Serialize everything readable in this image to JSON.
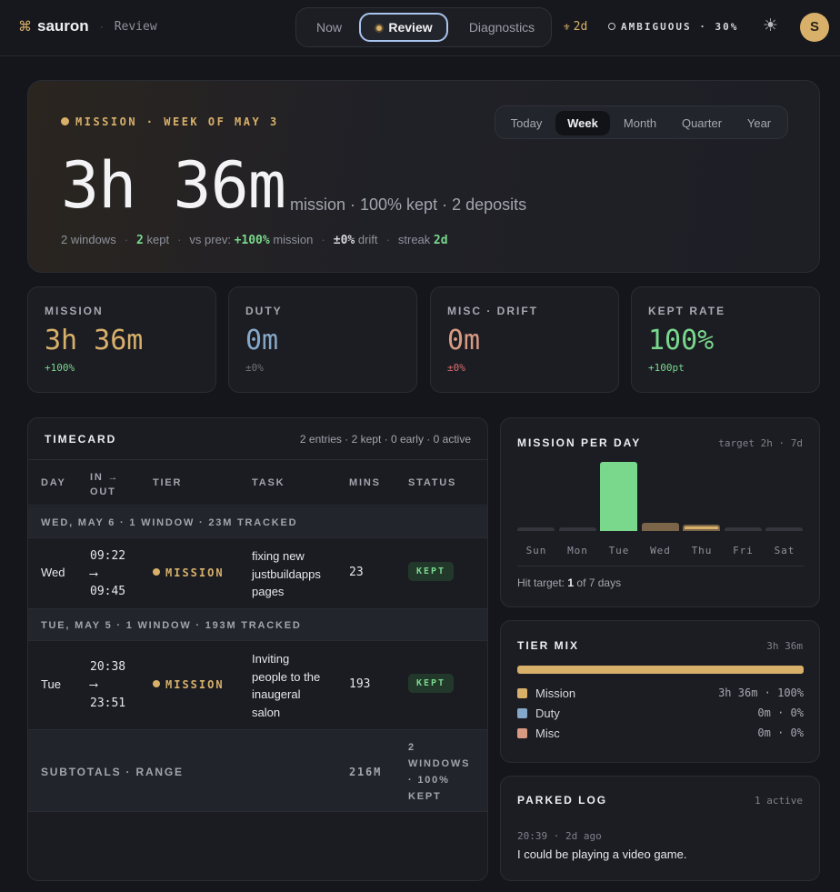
{
  "app": {
    "icon": "⌘",
    "name": "sauron",
    "separator": "·",
    "page": "Review"
  },
  "nav": {
    "tabs": [
      "Now",
      "Review",
      "Diagnostics"
    ],
    "active": "Review"
  },
  "status": {
    "streak_icon": "⚜",
    "streak": "2d",
    "mode": "AMBIGUOUS · 30%",
    "avatar": "S"
  },
  "hero": {
    "label": "MISSION · WEEK OF MAY 3",
    "ranges": [
      "Today",
      "Week",
      "Month",
      "Quarter",
      "Year"
    ],
    "active_range": "Week",
    "value": "3h 36m",
    "sub": "mission · 100% kept · 2 deposits",
    "meta": {
      "windows": "2 windows",
      "kept_count": "2",
      "kept_label": "kept",
      "prev_label": "vs prev:",
      "prev_value": "+100%",
      "prev_suffix": "mission",
      "drift_value": "±0%",
      "drift_label": "drift",
      "streak_label": "streak",
      "streak_value": "2d",
      "sep": "·"
    }
  },
  "stats": [
    {
      "label": "MISSION",
      "value": "3h 36m",
      "delta": "+100%",
      "color": "#d8b06a",
      "delta_color": "#79d88c"
    },
    {
      "label": "DUTY",
      "value": "0m",
      "delta": "±0%",
      "color": "#86a8c8",
      "delta_color": "#6f727c"
    },
    {
      "label": "MISC · DRIFT",
      "value": "0m",
      "delta": "±0%",
      "color": "#d99a82",
      "delta_color": "#d96f6f"
    },
    {
      "label": "KEPT RATE",
      "value": "100%",
      "delta": "+100pt",
      "color": "#79d88c",
      "delta_color": "#79d88c"
    }
  ],
  "timecard": {
    "title": "TIMECARD",
    "summary": "2 entries · 2 kept · 0 early · 0 active",
    "columns": {
      "day": "DAY",
      "inout_1": "IN →",
      "inout_2": "OUT",
      "tier": "TIER",
      "task": "TASK",
      "mins": "MINS",
      "status": "STATUS"
    },
    "groups": [
      {
        "header": "WED, MAY 6 · 1 WINDOW · 23M TRACKED",
        "row": {
          "day": "Wed",
          "in": "09:22",
          "arrow": "⟶",
          "out": "09:45",
          "tier": "MISSION",
          "task_lines": [
            "fixing new",
            "justbuildapps",
            "pages"
          ],
          "mins": "23",
          "status": "KEPT"
        }
      },
      {
        "header": "TUE, MAY 5 · 1 WINDOW · 193M TRACKED",
        "row": {
          "day": "Tue",
          "in": "20:38",
          "arrow": "⟶",
          "out": "23:51",
          "tier": "MISSION",
          "task_lines": [
            "Inviting",
            "people to the",
            "inaugeral",
            "salon"
          ],
          "mins": "193",
          "status": "KEPT"
        }
      }
    ],
    "subtotals": {
      "label": "SUBTOTALS · RANGE",
      "mins": "216M",
      "note_lines": [
        "2",
        "WINDOWS",
        "· 100%",
        "KEPT"
      ]
    }
  },
  "mission_per_day": {
    "title": "MISSION PER DAY",
    "aside": "target 2h · 7d",
    "hit_prefix": "Hit target:",
    "hit_count": "1",
    "hit_suffix": "of 7 days",
    "chart_data": {
      "type": "bar",
      "categories": [
        "Sun",
        "Mon",
        "Tue",
        "Wed",
        "Thu",
        "Fri",
        "Sat"
      ],
      "values": [
        0,
        0,
        193,
        23,
        0,
        0,
        0
      ],
      "unit": "min",
      "highlight": "Thu",
      "colors": {
        "hit": "#79d88c",
        "partial": "#7a6548",
        "empty": "#34353d",
        "today": "#d8b06a"
      }
    }
  },
  "tier_mix": {
    "title": "TIER MIX",
    "aside": "3h 36m",
    "bar_color": "#d8b06a",
    "items": [
      {
        "name": "Mission",
        "value": "3h 36m · 100%",
        "color": "#d8b06a",
        "share": 1.0
      },
      {
        "name": "Duty",
        "value": "0m · 0%",
        "color": "#86a8c8",
        "share": 0
      },
      {
        "name": "Misc",
        "value": "0m · 0%",
        "color": "#d99a82",
        "share": 0
      }
    ]
  },
  "parked_log": {
    "title": "PARKED LOG",
    "aside": "1 active",
    "entries": [
      {
        "time": "20:39 · 2d ago",
        "text": "I could be playing a video game."
      }
    ]
  }
}
